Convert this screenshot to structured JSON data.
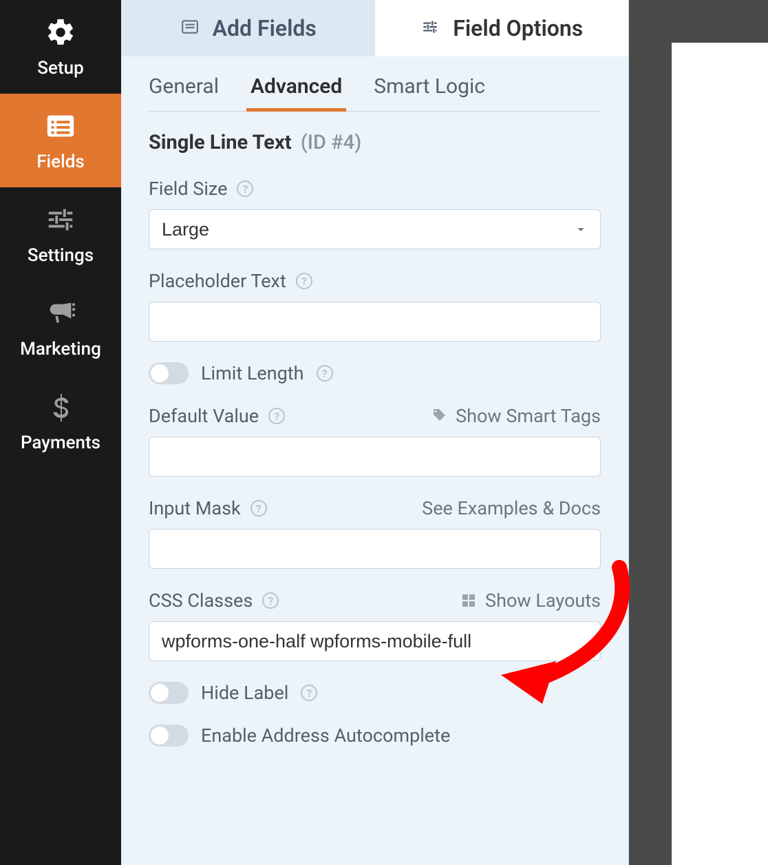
{
  "sidebar": {
    "items": [
      {
        "label": "Setup"
      },
      {
        "label": "Fields"
      },
      {
        "label": "Settings"
      },
      {
        "label": "Marketing"
      },
      {
        "label": "Payments"
      }
    ]
  },
  "top_tabs": {
    "add_fields": "Add Fields",
    "field_options": "Field Options"
  },
  "sub_tabs": {
    "general": "General",
    "advanced": "Advanced",
    "smart_logic": "Smart Logic"
  },
  "section": {
    "title": "Single Line Text",
    "id_suffix": "(ID #4)"
  },
  "fields": {
    "field_size": {
      "label": "Field Size",
      "value": "Large"
    },
    "placeholder_text": {
      "label": "Placeholder Text",
      "value": ""
    },
    "limit_length": {
      "label": "Limit Length"
    },
    "default_value": {
      "label": "Default Value",
      "action": "Show Smart Tags",
      "value": ""
    },
    "input_mask": {
      "label": "Input Mask",
      "action": "See Examples & Docs",
      "value": ""
    },
    "css_classes": {
      "label": "CSS Classes",
      "action": "Show Layouts",
      "value": "wpforms-one-half wpforms-mobile-full"
    },
    "hide_label": {
      "label": "Hide Label"
    },
    "address_autocomplete": {
      "label": "Enable Address Autocomplete"
    }
  }
}
